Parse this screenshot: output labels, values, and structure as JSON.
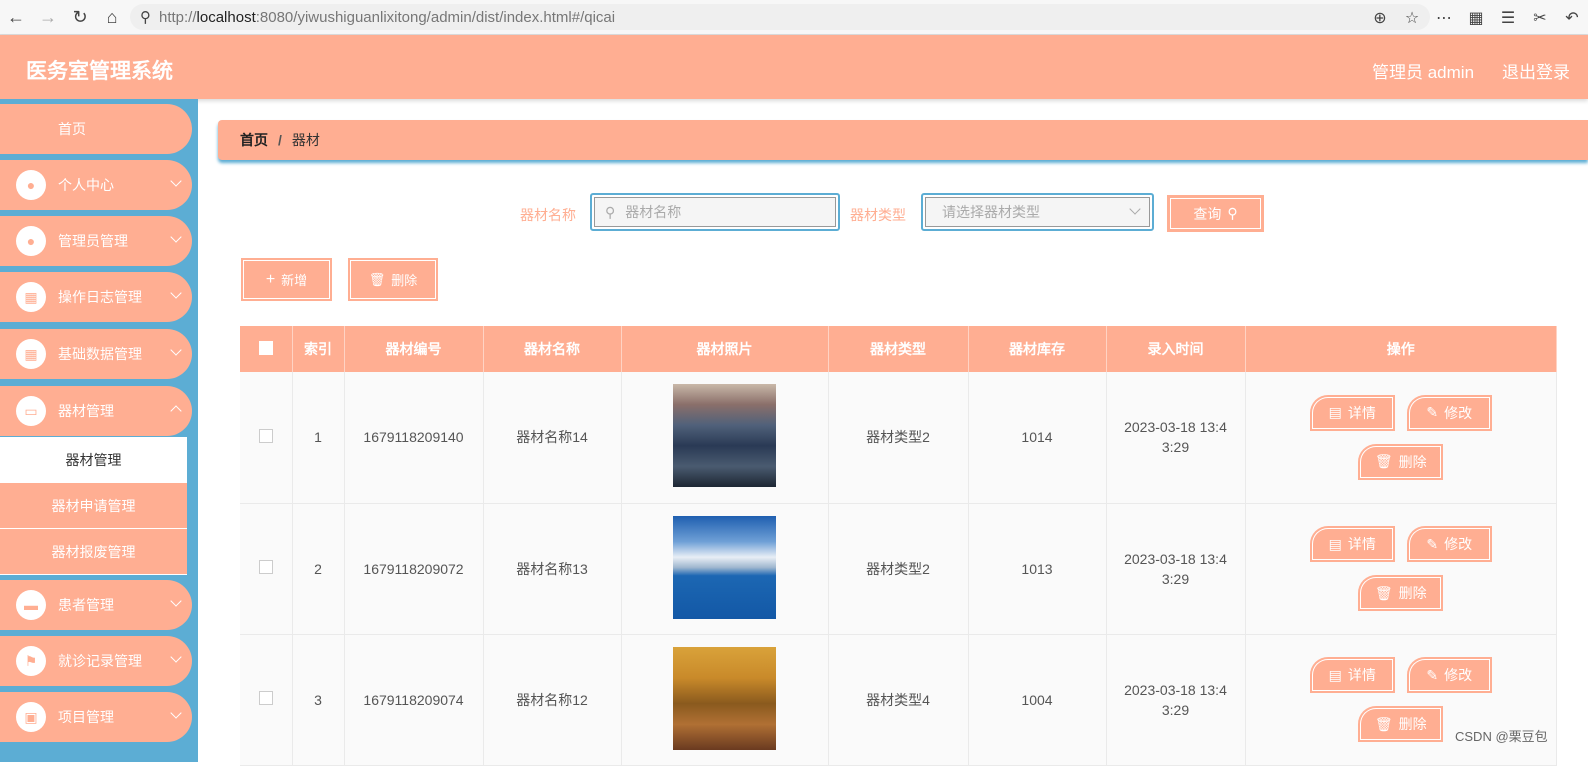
{
  "browser": {
    "url_scheme": "http://",
    "url_host": "localhost",
    "url_rest": ":8080/yiwushiguanlixitong/admin/dist/index.html#/qicai"
  },
  "header": {
    "title": "医务室管理系统",
    "user": "管理员 admin",
    "logout": "退出登录"
  },
  "sidebar": {
    "home": "首页",
    "items": [
      {
        "label": "个人中心",
        "icon": "user-icon"
      },
      {
        "label": "管理员管理",
        "icon": "user-icon"
      },
      {
        "label": "操作日志管理",
        "icon": "grid-icon"
      },
      {
        "label": "基础数据管理",
        "icon": "grid-icon"
      },
      {
        "label": "器材管理",
        "icon": "monitor-icon"
      },
      {
        "label": "患者管理",
        "icon": "chat-icon"
      },
      {
        "label": "就诊记录管理",
        "icon": "flag-icon"
      },
      {
        "label": "项目管理",
        "icon": "clipboard-icon"
      }
    ],
    "submenu": [
      "器材管理",
      "器材申请管理",
      "器材报废管理"
    ]
  },
  "breadcrumb": {
    "home": "首页",
    "sep": "/",
    "current": "器材"
  },
  "search": {
    "name_label": "器材名称",
    "name_placeholder": "器材名称",
    "type_label": "器材类型",
    "type_placeholder": "请选择器材类型",
    "query_button": "查询"
  },
  "actions": {
    "add": "新增",
    "delete": "删除"
  },
  "table": {
    "headers": [
      "索引",
      "器材编号",
      "器材名称",
      "器材照片",
      "器材类型",
      "器材库存",
      "录入时间",
      "操作"
    ],
    "rows": [
      {
        "index": "1",
        "code": "1679118209140",
        "name": "器材名称14",
        "type": "器材类型2",
        "stock": "1014",
        "time_line1": "2023-03-18 13:4",
        "time_line2": "3:29"
      },
      {
        "index": "2",
        "code": "1679118209072",
        "name": "器材名称13",
        "type": "器材类型2",
        "stock": "1013",
        "time_line1": "2023-03-18 13:4",
        "time_line2": "3:29"
      },
      {
        "index": "3",
        "code": "1679118209074",
        "name": "器材名称12",
        "type": "器材类型4",
        "stock": "1004",
        "time_line1": "2023-03-18 13:4",
        "time_line2": "3:29"
      }
    ],
    "row_actions": {
      "detail": "详情",
      "edit": "修改",
      "delete": "删除"
    }
  },
  "watermark": "CSDN @栗豆包",
  "colors": {
    "primary": "#ffae92",
    "sidebar_bg": "#5cadd4"
  }
}
